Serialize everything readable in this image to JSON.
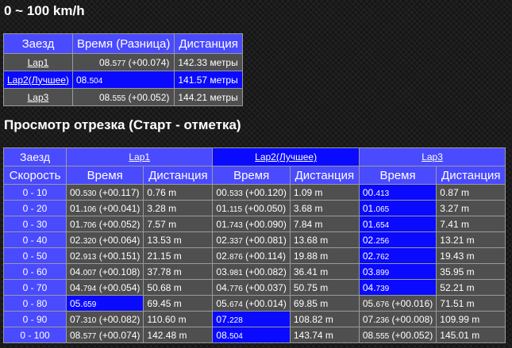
{
  "title": "0 ~ 100 km/h",
  "summary": {
    "headers": [
      "Заезд",
      "Время (Разница)",
      "Дистанция"
    ],
    "rows": [
      {
        "lap": "Lap1",
        "time": "08.",
        "time_ms": "577",
        "diff": " (+00.074)",
        "distance": "142.33 метры",
        "best": false
      },
      {
        "lap": "Lap2(Лучшее)",
        "time": "08.",
        "time_ms": "504",
        "diff": "",
        "distance": "141.57 метры",
        "best": true
      },
      {
        "lap": "Lap3",
        "time": "08.",
        "time_ms": "555",
        "diff": " (+00.052)",
        "distance": "144.21 метры",
        "best": false
      }
    ]
  },
  "segment_title": "Просмотр отрезка (Старт - отметка)",
  "segments": {
    "lap_header": "Заезд",
    "speed_header": "Скорость",
    "time_header": "Время",
    "distance_header": "Дистанция",
    "laps": [
      "Lap1",
      "Lap2(Лучшее)",
      "Lap3"
    ],
    "best_lap_index": 1,
    "rows": [
      {
        "speed": "0 - 10",
        "cells": [
          {
            "sec": "00.",
            "ms": "530",
            "diff": " (+00.117)",
            "dist": "0.76 m",
            "best": false
          },
          {
            "sec": "00.",
            "ms": "533",
            "diff": " (+00.120)",
            "dist": "1.09 m",
            "best": false
          },
          {
            "sec": "00.",
            "ms": "413",
            "diff": "",
            "dist": "0.87 m",
            "best": true
          }
        ]
      },
      {
        "speed": "0 - 20",
        "cells": [
          {
            "sec": "01.",
            "ms": "106",
            "diff": " (+00.041)",
            "dist": "3.28 m",
            "best": false
          },
          {
            "sec": "01.",
            "ms": "115",
            "diff": " (+00.050)",
            "dist": "3.68 m",
            "best": false
          },
          {
            "sec": "01.",
            "ms": "065",
            "diff": "",
            "dist": "3.27 m",
            "best": true
          }
        ]
      },
      {
        "speed": "0 - 30",
        "cells": [
          {
            "sec": "01.",
            "ms": "706",
            "diff": " (+00.052)",
            "dist": "7.57 m",
            "best": false
          },
          {
            "sec": "01.",
            "ms": "743",
            "diff": " (+00.090)",
            "dist": "7.84 m",
            "best": false
          },
          {
            "sec": "01.",
            "ms": "654",
            "diff": "",
            "dist": "7.41 m",
            "best": true
          }
        ]
      },
      {
        "speed": "0 - 40",
        "cells": [
          {
            "sec": "02.",
            "ms": "320",
            "diff": " (+00.064)",
            "dist": "13.53 m",
            "best": false
          },
          {
            "sec": "02.",
            "ms": "337",
            "diff": " (+00.081)",
            "dist": "13.68 m",
            "best": false
          },
          {
            "sec": "02.",
            "ms": "256",
            "diff": "",
            "dist": "13.21 m",
            "best": true
          }
        ]
      },
      {
        "speed": "0 - 50",
        "cells": [
          {
            "sec": "02.",
            "ms": "913",
            "diff": " (+00.151)",
            "dist": "21.15 m",
            "best": false
          },
          {
            "sec": "02.",
            "ms": "876",
            "diff": " (+00.114)",
            "dist": "19.88 m",
            "best": false
          },
          {
            "sec": "02.",
            "ms": "762",
            "diff": "",
            "dist": "19.43 m",
            "best": true
          }
        ]
      },
      {
        "speed": "0 - 60",
        "cells": [
          {
            "sec": "04.",
            "ms": "007",
            "diff": " (+00.108)",
            "dist": "37.78 m",
            "best": false
          },
          {
            "sec": "03.",
            "ms": "981",
            "diff": " (+00.082)",
            "dist": "36.41 m",
            "best": false
          },
          {
            "sec": "03.",
            "ms": "899",
            "diff": "",
            "dist": "35.95 m",
            "best": true
          }
        ]
      },
      {
        "speed": "0 - 70",
        "cells": [
          {
            "sec": "04.",
            "ms": "794",
            "diff": " (+00.054)",
            "dist": "50.68 m",
            "best": false
          },
          {
            "sec": "04.",
            "ms": "776",
            "diff": " (+00.037)",
            "dist": "50.75 m",
            "best": false
          },
          {
            "sec": "04.",
            "ms": "739",
            "diff": "",
            "dist": "52.21 m",
            "best": true
          }
        ]
      },
      {
        "speed": "0 - 80",
        "cells": [
          {
            "sec": "05.",
            "ms": "659",
            "diff": "",
            "dist": "69.45 m",
            "best": true
          },
          {
            "sec": "05.",
            "ms": "674",
            "diff": " (+00.014)",
            "dist": "69.85 m",
            "best": false
          },
          {
            "sec": "05.",
            "ms": "676",
            "diff": " (+00.016)",
            "dist": "71.51 m",
            "best": false
          }
        ]
      },
      {
        "speed": "0 - 90",
        "cells": [
          {
            "sec": "07.",
            "ms": "310",
            "diff": " (+00.082)",
            "dist": "110.60 m",
            "best": false
          },
          {
            "sec": "07.",
            "ms": "228",
            "diff": "",
            "dist": "108.82 m",
            "best": true
          },
          {
            "sec": "07.",
            "ms": "236",
            "diff": " (+00.008)",
            "dist": "109.99 m",
            "best": false
          }
        ]
      },
      {
        "speed": "0 - 100",
        "cells": [
          {
            "sec": "08.",
            "ms": "577",
            "diff": " (+00.074)",
            "dist": "142.48 m",
            "best": false
          },
          {
            "sec": "08.",
            "ms": "504",
            "diff": "",
            "dist": "143.74 m",
            "best": true
          },
          {
            "sec": "08.",
            "ms": "555",
            "diff": " (+00.052)",
            "dist": "145.01 m",
            "best": false
          }
        ]
      }
    ]
  },
  "colors": {
    "header_blue": "#4a4aff",
    "best_blue": "#0a0aff",
    "cell_gray": "#4f4f4f"
  }
}
